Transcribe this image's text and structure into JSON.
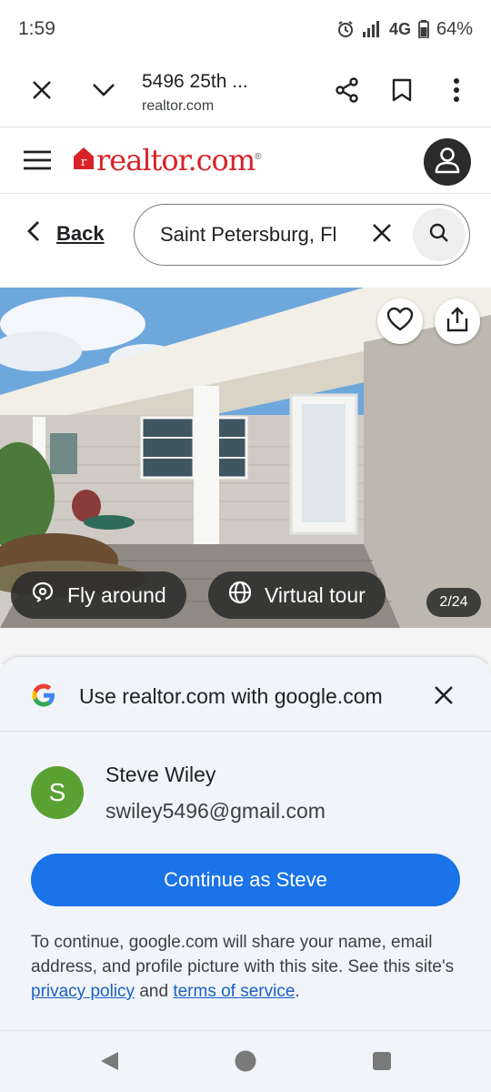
{
  "status_bar": {
    "time": "1:59",
    "network": "4G",
    "battery": "64%",
    "icons": [
      "alarm-icon",
      "signal-icon",
      "battery-icon"
    ]
  },
  "custom_tab": {
    "title": "5496 25th ...",
    "url": "realtor.com",
    "icons": [
      "close-icon",
      "chevron-down-icon",
      "share-icon",
      "bookmark-icon",
      "more-vert-icon"
    ]
  },
  "site_header": {
    "logo_text": "realtor.com",
    "logo_mark": "®",
    "brand_color": "#d92228"
  },
  "nav": {
    "back_label": "Back",
    "search_value": "Saint Petersburg, Fl"
  },
  "photo": {
    "fly_around_label": "Fly around",
    "virtual_tour_label": "Virtual tour",
    "counter": "2/24"
  },
  "google_sheet": {
    "title": "Use realtor.com with google.com",
    "account": {
      "initial": "S",
      "name": "Steve Wiley",
      "email": "swiley5496@gmail.com"
    },
    "continue_label": "Continue as Steve",
    "consent_prefix": "To continue, google.com will share your name, email address, and profile picture with this site. See this site's",
    "privacy_link": "privacy policy",
    "consent_and": "and",
    "terms_link": "terms of service",
    "consent_suffix": ".",
    "accent_color": "#1a73e8"
  }
}
